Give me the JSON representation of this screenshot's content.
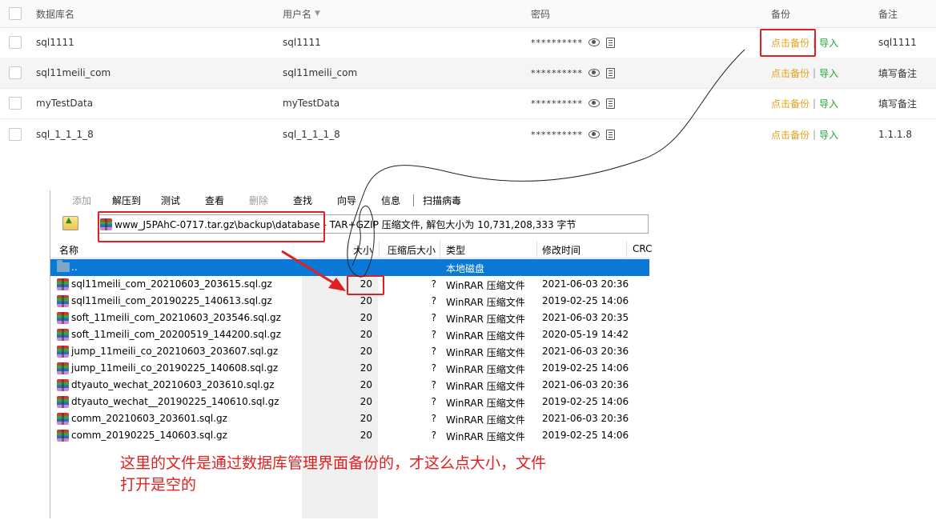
{
  "db_table": {
    "headers": {
      "name": "数据库名",
      "user": "用户名",
      "password": "密码",
      "backup": "备份",
      "note": "备注"
    },
    "rows": [
      {
        "name": "sql1111",
        "user": "sql1111",
        "password": "**********",
        "backup": "点击备份",
        "import": "导入",
        "note": "sql1111"
      },
      {
        "name": "sql11meili_com",
        "user": "sql11meili_com",
        "password": "**********",
        "backup": "点击备份",
        "import": "导入",
        "note": "填写备注"
      },
      {
        "name": "myTestData",
        "user": "myTestData",
        "password": "**********",
        "backup": "点击备份",
        "import": "导入",
        "note": "填写备注"
      },
      {
        "name": "sql_1_1_1_8",
        "user": "sql_1_1_1_8",
        "password": "**********",
        "backup": "点击备份",
        "import": "导入",
        "note": "1.1.1.8"
      }
    ],
    "separator": "|"
  },
  "winrar": {
    "toolbar": [
      "添加",
      "解压到",
      "测试",
      "查看",
      "删除",
      "查找",
      "向导",
      "信息",
      "扫描病毒"
    ],
    "path": "www_J5PAhC-0717.tar.gz\\backup\\database - TAR+GZIP 压缩文件, 解包大小为 10,731,208,333 字节",
    "columns": {
      "name": "名称",
      "size": "大小",
      "packed": "压缩后大小",
      "type": "类型",
      "modified": "修改时间",
      "crc": "CRC"
    },
    "parent": {
      "name": "..",
      "type": "本地磁盘"
    },
    "files": [
      {
        "name": "sql11meili_com_20210603_203615.sql.gz",
        "size": "20",
        "packed": "?",
        "type": "WinRAR 压缩文件",
        "modified": "2021-06-03 20:36"
      },
      {
        "name": "sql11meili_com_20190225_140613.sql.gz",
        "size": "20",
        "packed": "?",
        "type": "WinRAR 压缩文件",
        "modified": "2019-02-25 14:06"
      },
      {
        "name": "soft_11meili_com_20210603_203546.sql.gz",
        "size": "20",
        "packed": "?",
        "type": "WinRAR 压缩文件",
        "modified": "2021-06-03 20:35"
      },
      {
        "name": "soft_11meili_com_20200519_144200.sql.gz",
        "size": "20",
        "packed": "?",
        "type": "WinRAR 压缩文件",
        "modified": "2020-05-19 14:42"
      },
      {
        "name": "jump_11meili_co_20210603_203607.sql.gz",
        "size": "20",
        "packed": "?",
        "type": "WinRAR 压缩文件",
        "modified": "2021-06-03 20:36"
      },
      {
        "name": "jump_11meili_co_20190225_140608.sql.gz",
        "size": "20",
        "packed": "?",
        "type": "WinRAR 压缩文件",
        "modified": "2019-02-25 14:06"
      },
      {
        "name": "dtyauto_wechat_20210603_203610.sql.gz",
        "size": "20",
        "packed": "?",
        "type": "WinRAR 压缩文件",
        "modified": "2021-06-03 20:36"
      },
      {
        "name": "dtyauto_wechat__20190225_140610.sql.gz",
        "size": "20",
        "packed": "?",
        "type": "WinRAR 压缩文件",
        "modified": "2019-02-25 14:06"
      },
      {
        "name": "comm_20210603_203601.sql.gz",
        "size": "20",
        "packed": "?",
        "type": "WinRAR 压缩文件",
        "modified": "2021-06-03 20:36"
      },
      {
        "name": "comm_20190225_140603.sql.gz",
        "size": "20",
        "packed": "?",
        "type": "WinRAR 压缩文件",
        "modified": "2019-02-25 14:06"
      }
    ]
  },
  "annotation": {
    "line1": "这里的文件是通过数据库管理界面备份的，才这么点大小，文件",
    "line2": "打开是空的",
    "color": "#e02020"
  }
}
